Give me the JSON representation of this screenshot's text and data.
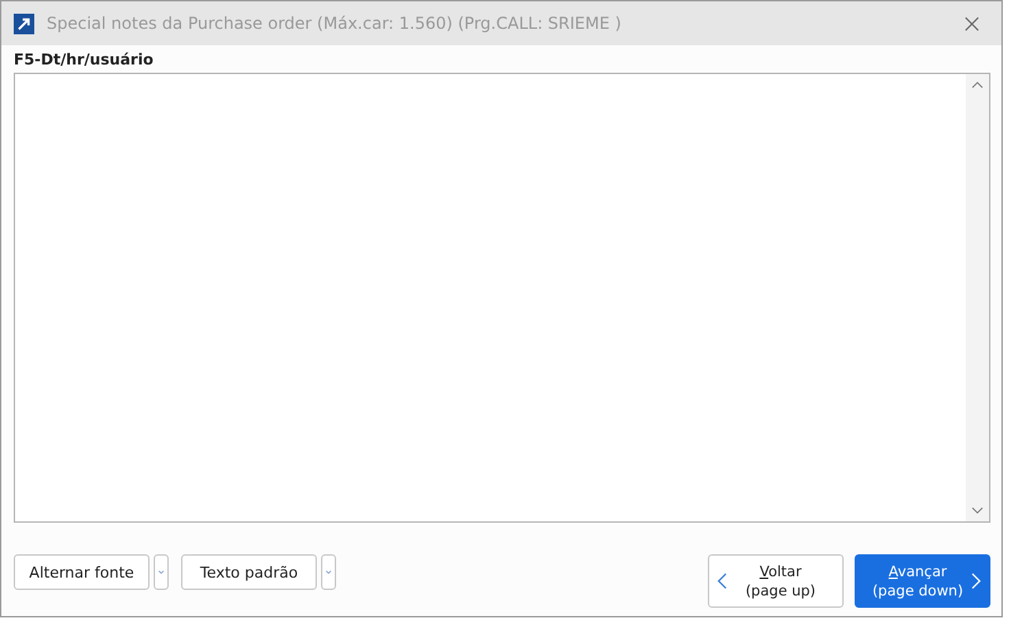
{
  "window": {
    "title": "Special notes da Purchase order (Máx.car:  1.560) (Prg.CALL: SRIEME  )"
  },
  "field": {
    "label": "F5-Dt/hr/usuário"
  },
  "left_buttons": [
    {
      "label": "Alternar fonte"
    },
    {
      "label": "Texto padrão"
    }
  ],
  "nav_buttons": [
    {
      "kind": "back",
      "label": "Voltar",
      "sub": "(page up)"
    },
    {
      "kind": "next",
      "label": "Avançar",
      "sub": "(page down)"
    }
  ]
}
